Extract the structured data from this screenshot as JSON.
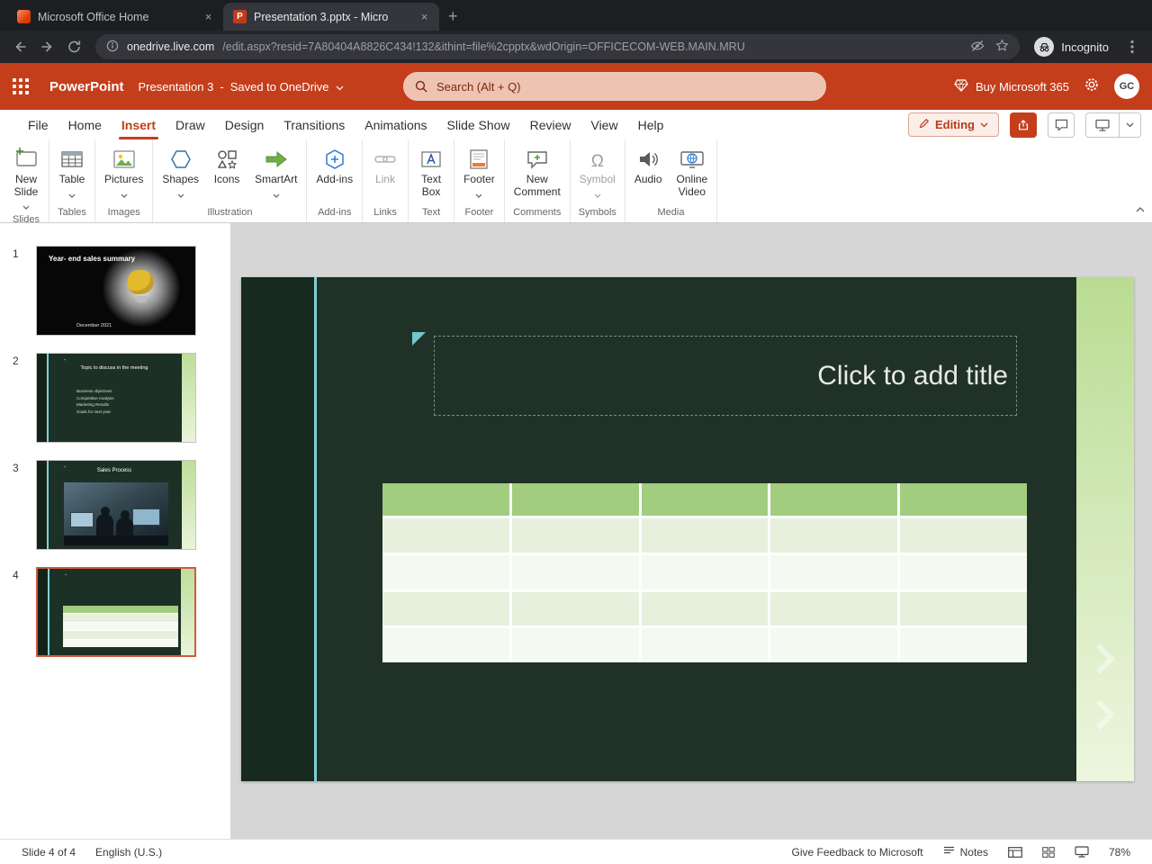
{
  "colors": {
    "chrome_dark": "#1d1e22",
    "chrome_toolbar": "#242528",
    "chrome_pill": "#35363b",
    "ppt_red": "#c43e1c",
    "menu_accent": "#c43e1c",
    "canvas_gray": "#d6d6d6",
    "slide_green": "#203227",
    "slide_band_dark": "#182a1f",
    "teal_accent": "#7ed0d2",
    "band_light_green": "#b9dc92",
    "table_header_green": "#a2cc7e",
    "table_row_light": "#e6f0dc",
    "table_row_lighter": "#f4f9f1",
    "selected_thumb_border": "#cf5b3c"
  },
  "glyphs": {
    "close": "×",
    "plus": "+"
  },
  "browser": {
    "tabs": [
      {
        "title": "Microsoft Office Home"
      },
      {
        "title": "Presentation 3.pptx - Micro"
      }
    ],
    "url_host": "onedrive.live.com",
    "url_path": "/edit.aspx?resid=7A80404A8826C434!132&ithint=file%2cpptx&wdOrigin=OFFICECOM-WEB.MAIN.MRU",
    "incognito_label": "Incognito",
    "ppt_favicon_letter": "P"
  },
  "appbar": {
    "app_name": "PowerPoint",
    "doc_title": "Presentation 3",
    "separator": "-",
    "saved_status": "Saved to OneDrive",
    "search_placeholder": "Search (Alt + Q)",
    "buy_label": "Buy Microsoft 365",
    "avatar_initials": "GC"
  },
  "menubar": {
    "items": [
      {
        "label": "File"
      },
      {
        "label": "Home"
      },
      {
        "label": "Insert"
      },
      {
        "label": "Draw"
      },
      {
        "label": "Design"
      },
      {
        "label": "Transitions"
      },
      {
        "label": "Animations"
      },
      {
        "label": "Slide Show"
      },
      {
        "label": "Review"
      },
      {
        "label": "View"
      },
      {
        "label": "Help"
      }
    ],
    "editing_label": "Editing"
  },
  "ribbon": {
    "buttons": [
      {
        "line1": "New",
        "line2": "Slide"
      },
      {
        "line1": "Table",
        "line2": ""
      },
      {
        "line1": "Pictures",
        "line2": ""
      },
      {
        "line1": "Shapes",
        "line2": ""
      },
      {
        "line1": "Icons",
        "line2": ""
      },
      {
        "line1": "SmartArt",
        "line2": ""
      },
      {
        "line1": "Add-ins",
        "line2": ""
      },
      {
        "line1": "Link",
        "line2": ""
      },
      {
        "line1": "Text",
        "line2": "Box"
      },
      {
        "line1": "Footer",
        "line2": ""
      },
      {
        "line1": "New",
        "line2": "Comment"
      },
      {
        "line1": "Symbol",
        "line2": ""
      },
      {
        "line1": "Audio",
        "line2": ""
      },
      {
        "line1": "Online",
        "line2": "Video"
      }
    ],
    "groups": [
      "Slides",
      "Tables",
      "Images",
      "Illustration",
      "Add-ins",
      "Links",
      "Text",
      "Footer",
      "Comments",
      "Symbols",
      "Media"
    ],
    "symbol_glyph": "Ω"
  },
  "panel": {
    "slides": [
      {
        "num": "1",
        "title_line1": "Year- end",
        "title_line2": "sales",
        "title_line3": "summary",
        "date": "December 2021"
      },
      {
        "num": "2",
        "dash": "-",
        "title": "Topic to discuss in the meeting",
        "bullets": [
          "Business objectives",
          "Competitive Analysis",
          "Marketing Results",
          "Goals for next year"
        ]
      },
      {
        "num": "3",
        "dash": "-",
        "title": "Sales Process"
      },
      {
        "num": "4",
        "dash": "-"
      }
    ]
  },
  "slide_editor": {
    "title_placeholder": "Click to add title"
  },
  "statusbar": {
    "slide_info": "Slide 4 of 4",
    "language": "English (U.S.)",
    "feedback": "Give Feedback to Microsoft",
    "notes_label": "Notes",
    "zoom": "78%"
  }
}
